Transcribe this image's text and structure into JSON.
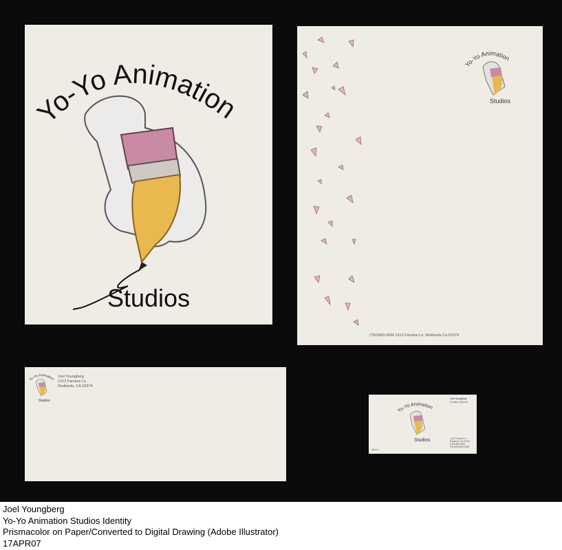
{
  "logo": {
    "arc_text": "Yo-Yo Animation",
    "studios_text": "Studios"
  },
  "letterhead": {
    "footer": "(760)680-0934 1313 Farview Ln, Redlands Ca 92374"
  },
  "envelope": {
    "name": "Joel Youngberg",
    "address1": "1313 Farview Ln.",
    "address2": "Redlands, CA 92374"
  },
  "business_card": {
    "name": "Joel Youngberg",
    "title": "Creative Director",
    "address_lines": [
      "1313 Farview Ln.",
      "Redlands, Ca 92374",
      "(760) 680-0934",
      "Fax (909) 881-2556"
    ],
    "email": "Jyoun..."
  },
  "caption": {
    "line1": "Joel Youngberg",
    "line2": "Yo-Yo Animation Studios Identity",
    "line3": "Prismacolor on Paper/Converted to Digital Drawing (Adobe Illustrator)",
    "line4": "17APR07"
  },
  "colors": {
    "board": "#0b0b0b",
    "paper": "#efece6",
    "eraser": "#c98aa6",
    "pencil": "#e8b94f"
  }
}
